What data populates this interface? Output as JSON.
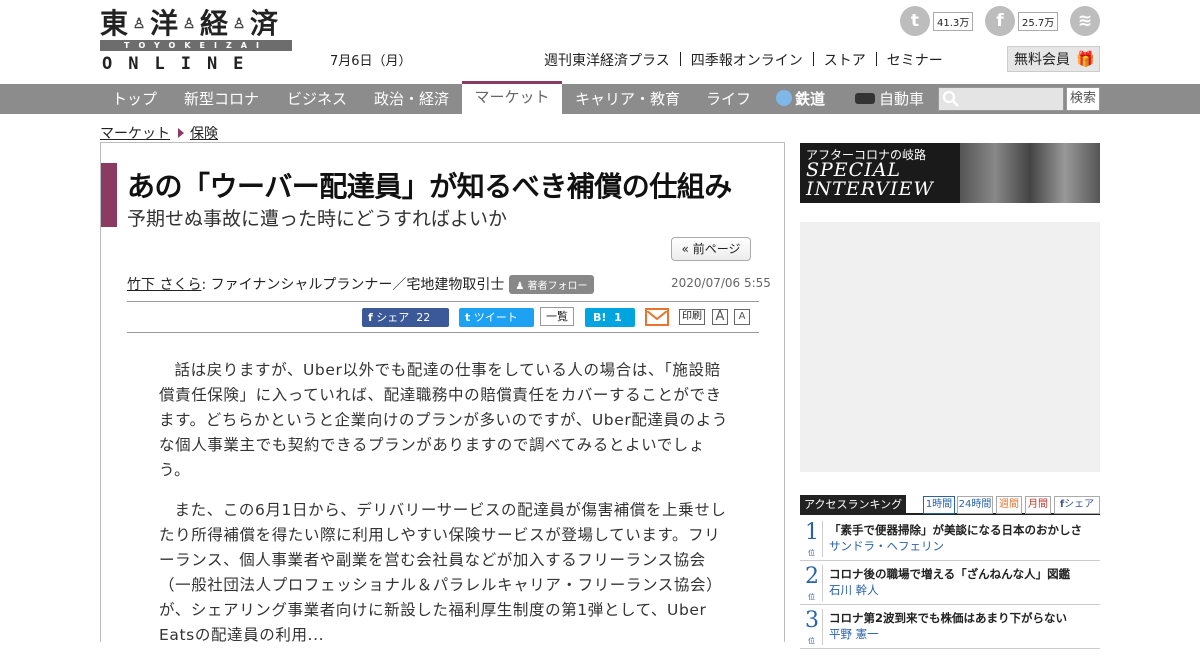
{
  "header": {
    "logo_kanji": [
      "東",
      "洋",
      "経",
      "済"
    ],
    "logo_band": "TOYOKEIZAI",
    "logo_online": "ONLINE",
    "date": "7月6日（月）",
    "top_links": [
      "週刊東洋経済プラス",
      "四季報オンライン",
      "ストア",
      "セミナー"
    ],
    "member_label": "無料会員",
    "social": {
      "twitter_count": "41.3万",
      "facebook_count": "25.7万",
      "twitter_glyph": "t",
      "facebook_glyph": "f",
      "rss_glyph": "≋"
    }
  },
  "nav": {
    "items": [
      "トップ",
      "新型コロナ",
      "ビジネス",
      "政治・経済",
      "マーケット",
      "キャリア・教育",
      "ライフ",
      "鉄道",
      "自動車"
    ],
    "active": "マーケット",
    "search_button": "検索"
  },
  "breadcrumb": [
    "マーケット",
    "保険"
  ],
  "article": {
    "title": "あの「ウーバー配達員」が知るべき補償の仕組み",
    "subtitle": "予期せぬ事故に遭った時にどうすればよいか",
    "prev_page": "« 前ページ",
    "author": "竹下 さくら",
    "author_role": ": ファイナンシャルプランナー／宅地建物取引士",
    "follow_label": "著者フォロー",
    "pubdate": "2020/07/06 5:55",
    "share": {
      "fb_label": "シェア",
      "fb_count": "22",
      "tw_label": "ツイート",
      "tw_count": "一覧",
      "hb_label": "B!",
      "hb_count": "1",
      "print_label": "印刷",
      "font_a": "A"
    },
    "paragraphs": [
      "話は戻りますが、Uber以外でも配達の仕事をしている人の場合は、「施設賠償責任保険」に入っていれば、配達職務中の賠償責任をカバーすることができます。どちらかというと企業向けのプランが多いのですが、Uber配達員のような個人事業主でも契約できるプランがありますので調べてみるとよいでしょう。",
      "また、この6月1日から、デリバリーサービスの配達員が傷害補償を上乗せしたり所得補償を得たい際に利用しやすい保険サービスが登場しています。フリーランス、個人事業者や副業を営む会社員などが加入するフリーランス協会（一般社団法人プロフェッショナル＆パラレルキャリア・フリーランス協会）が、シェアリング事業者向けに新設した福利厚生制度の第1弾として、Uber Eatsの配達員の利用..."
    ]
  },
  "sidebar": {
    "banner_top": "アフターコロナの岐路",
    "banner_main_1": "SPECIAL",
    "banner_main_2": "INTERVIEW",
    "ranking_label": "アクセスランキング",
    "ranking_tabs": [
      "1時間",
      "24時間",
      "週間",
      "月間",
      "シェア"
    ],
    "ranking": [
      {
        "num": "1",
        "pos": "位",
        "title": "「素手で便器掃除」が美談になる日本のおかしさ",
        "author": "サンドラ・ヘフェリン"
      },
      {
        "num": "2",
        "pos": "位",
        "title": "コロナ後の職場で増える「ざんねんな人」図鑑",
        "author": "石川 幹人"
      },
      {
        "num": "3",
        "pos": "位",
        "title": "コロナ第2波到来でも株価はあまり下がらない",
        "author": "平野 憲一"
      }
    ]
  },
  "colors": {
    "accent": "#8b3a62",
    "nav_bg": "#8c8c8c",
    "link_blue": "#2a62a8"
  }
}
